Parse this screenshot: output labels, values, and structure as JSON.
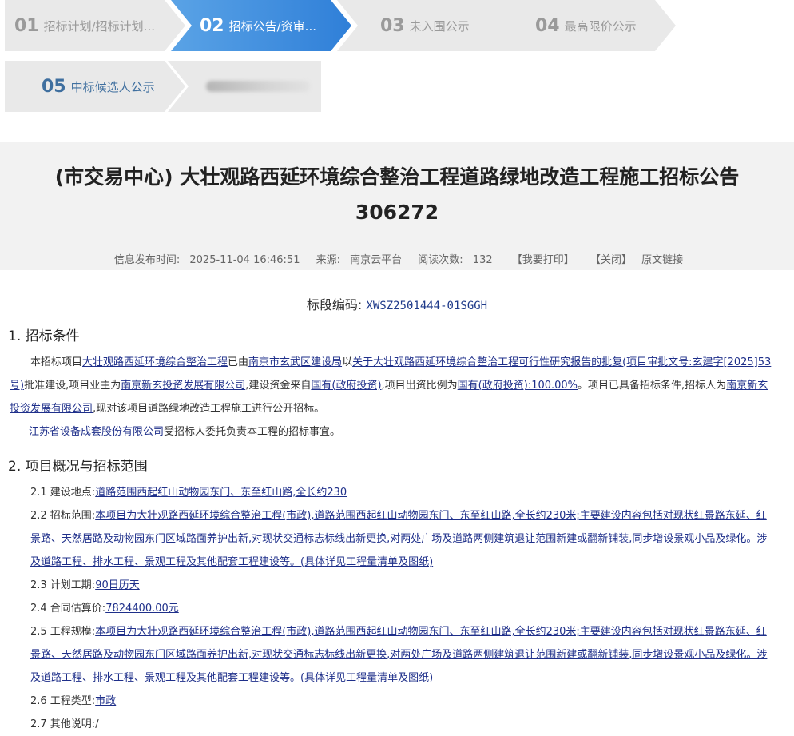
{
  "steps": [
    {
      "num": "01",
      "label": "招标计划/招标计划..."
    },
    {
      "num": "02",
      "label": "招标公告/资审..."
    },
    {
      "num": "03",
      "label": "未入围公示"
    },
    {
      "num": "04",
      "label": "最高限价公示"
    },
    {
      "num": "05",
      "label": "中标候选人公示"
    }
  ],
  "title_line1": "(市交易中心) 大壮观路西延环境综合整治工程道路绿地改造工程施工招标公告",
  "title_line2": "306272",
  "meta": {
    "publish_label": "信息发布时间:",
    "publish_time": "2025-11-04 16:46:51",
    "source_label": "来源:",
    "source": "南京云平台",
    "views_label": "阅读次数:",
    "views": "132",
    "print": "【我要打印】",
    "close": "【关闭】",
    "origin": "原文链接"
  },
  "code_label": "标段编码:",
  "code_value": "XWSZ2501444-01SGGH",
  "sec1": {
    "heading": "1. 招标条件",
    "p1": {
      "t1": "本招标项目",
      "u1": "大壮观路西延环境综合整治工程",
      "t2": "已由",
      "u2": "南京市玄武区建设局",
      "t3": "以",
      "u3": "关于大壮观路西延环境综合整治工程可行性研究报告的批复(项目审批文号:玄建字[2025]53号)",
      "t4": "批准建设,项目业主为",
      "u4": "南京新玄投资发展有限公司",
      "t5": ",建设资金来自",
      "u5": "国有(政府投资)",
      "t6": ",项目出资比例为",
      "u6": "国有(政府投资):100.00%",
      "t7": "。项目已具备招标条件,招标人为",
      "u7": "南京新玄投资发展有限公司",
      "t8": ",现对该项目道路绿地改造工程施工进行公开招标。"
    },
    "p2": {
      "u1": "江苏省设备成套股份有限公司",
      "t1": "受招标人委托负责本工程的招标事宜。"
    }
  },
  "sec2": {
    "heading": "2. 项目概况与招标范围",
    "items": [
      {
        "label": "2.1 建设地点:",
        "value": "道路范围西起红山动物园东门、东至红山路,全长约230"
      },
      {
        "label": "2.2 招标范围:",
        "value": "本项目为大壮观路西延环境综合整治工程(市政),道路范围西起红山动物园东门、东至红山路,全长约230米;主要建设内容包括对现状红景路东延、红景路、天然居路及动物园东门区域路面养护出新,对现状交通标志标线出新更换,对两处广场及道路两侧建筑退让范围新建或翻新铺装,同步增设景观小品及绿化。涉及道路工程、排水工程、景观工程及其他配套工程建设等。(具体详见工程量清单及图纸)"
      },
      {
        "label": "2.3 计划工期:",
        "value": "90日历天"
      },
      {
        "label": "2.4 合同估算价:",
        "value": "7824400.00元"
      },
      {
        "label": "2.5 工程规模:",
        "value": "本项目为大壮观路西延环境综合整治工程(市政),道路范围西起红山动物园东门、东至红山路,全长约230米;主要建设内容包括对现状红景路东延、红景路、天然居路及动物园东门区域路面养护出新,对现状交通标志标线出新更换,对两处广场及道路两侧建筑退让范围新建或翻新铺装,同步增设景观小品及绿化。涉及道路工程、排水工程、景观工程及其他配套工程建设等。(具体详见工程量清单及图纸)"
      },
      {
        "label": "2.6 工程类型:",
        "value": "市政"
      },
      {
        "label": "2.7 其他说明:",
        "value": "/"
      }
    ]
  }
}
